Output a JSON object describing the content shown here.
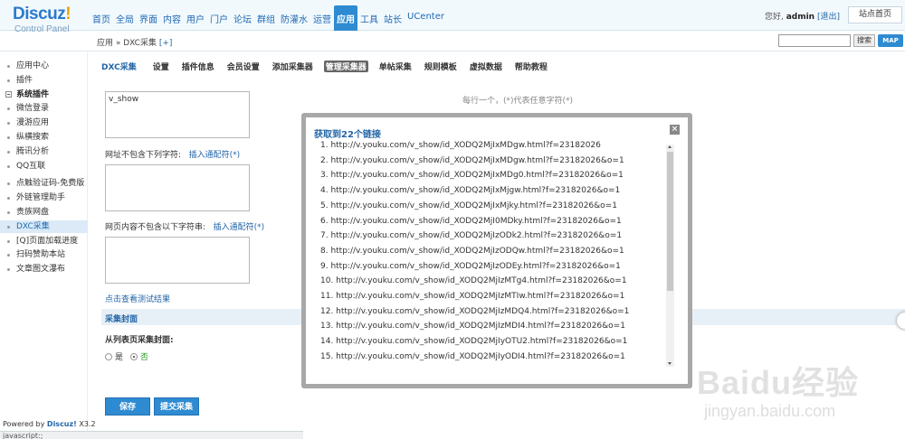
{
  "header": {
    "logo_main": "Discuz",
    "logo_excl": "!",
    "logo_sub": "Control Panel",
    "nav": [
      "首页",
      "全局",
      "界面",
      "内容",
      "用户",
      "门户",
      "论坛",
      "群组",
      "防灌水",
      "运营",
      "应用",
      "工具",
      "站长",
      "UCenter"
    ],
    "active_nav": "应用",
    "greeting": "您好, ",
    "username": "admin",
    "logout": "[退出]",
    "site_home": "站点首页"
  },
  "subbar": {
    "breadcrumb": "应用 » DXC采集",
    "add": "[+]",
    "search_button": "搜索",
    "map_button": "MAP"
  },
  "sidebar": {
    "items": [
      "应用中心",
      "插件"
    ],
    "group_label": "系统插件",
    "group_items": [
      "微信登录",
      "漫游应用",
      "纵横搜索",
      "腾讯分析",
      "QQ互联"
    ],
    "more_items": [
      "点触验证码-免费版",
      "外链管理助手",
      "贵族网盘",
      "DXC采集",
      "[Q]页面加载进度",
      "扫码赞助本站",
      "文章图文瀑布"
    ],
    "active_item": "DXC采集",
    "powered_prefix": "Powered by ",
    "powered_brand": "Discuz!",
    "powered_version": " X3.2",
    "status_text": "javascript:;"
  },
  "main": {
    "tab_title": "DXC采集",
    "tabs": [
      "设置",
      "插件信息",
      "会员设置",
      "添加采集器",
      "管理采集器",
      "单帖采集",
      "规则模板",
      "虚拟数据",
      "帮助教程"
    ],
    "active_tab": "管理采集器",
    "textarea1_value": "v_show",
    "hint_text": "每行一个，(*)代表任意字符(*)",
    "label2": "网址不包含下列字符:",
    "label2_link": "插入通配符(*)",
    "label3": "网页内容不包含以下字符串:",
    "label3_link": "插入通配符(*)",
    "test_link": "点击查看测试结果",
    "section_title": "采集封面",
    "cover_label": "从列表页采集封面:",
    "radio_yes": "是",
    "radio_no": "否",
    "save_button": "保存",
    "submit_button": "提交采集"
  },
  "modal": {
    "title": "获取到22个链接",
    "close": "×",
    "links": [
      "1. http://v.youku.com/v_show/id_XODQ2MjIxMDgw.html?f=23182026",
      "2. http://v.youku.com/v_show/id_XODQ2MjIxMDgw.html?f=23182026&o=1",
      "3. http://v.youku.com/v_show/id_XODQ2MjIxMDg0.html?f=23182026&o=1",
      "4. http://v.youku.com/v_show/id_XODQ2MjIxMjgw.html?f=23182026&o=1",
      "5. http://v.youku.com/v_show/id_XODQ2MjIxMjky.html?f=23182026&o=1",
      "6. http://v.youku.com/v_show/id_XODQ2MjI0MDky.html?f=23182026&o=1",
      "7. http://v.youku.com/v_show/id_XODQ2MjIzODk2.html?f=23182026&o=1",
      "8. http://v.youku.com/v_show/id_XODQ2MjIzODQw.html?f=23182026&o=1",
      "9. http://v.youku.com/v_show/id_XODQ2MjIzODEy.html?f=23182026&o=1",
      "10. http://v.youku.com/v_show/id_XODQ2MjIzMTg4.html?f=23182026&o=1",
      "11. http://v.youku.com/v_show/id_XODQ2MjIzMTIw.html?f=23182026&o=1",
      "12. http://v.youku.com/v_show/id_XODQ2MjIzMDQ4.html?f=23182026&o=1",
      "13. http://v.youku.com/v_show/id_XODQ2MjIzMDI4.html?f=23182026&o=1",
      "14. http://v.youku.com/v_show/id_XODQ2MjIyOTU2.html?f=23182026&o=1",
      "15. http://v.youku.com/v_show/id_XODQ2MjIyODI4.html?f=23182026&o=1"
    ]
  },
  "watermark": {
    "main": "Baidu经验",
    "sub": "jingyan.baidu.com"
  }
}
